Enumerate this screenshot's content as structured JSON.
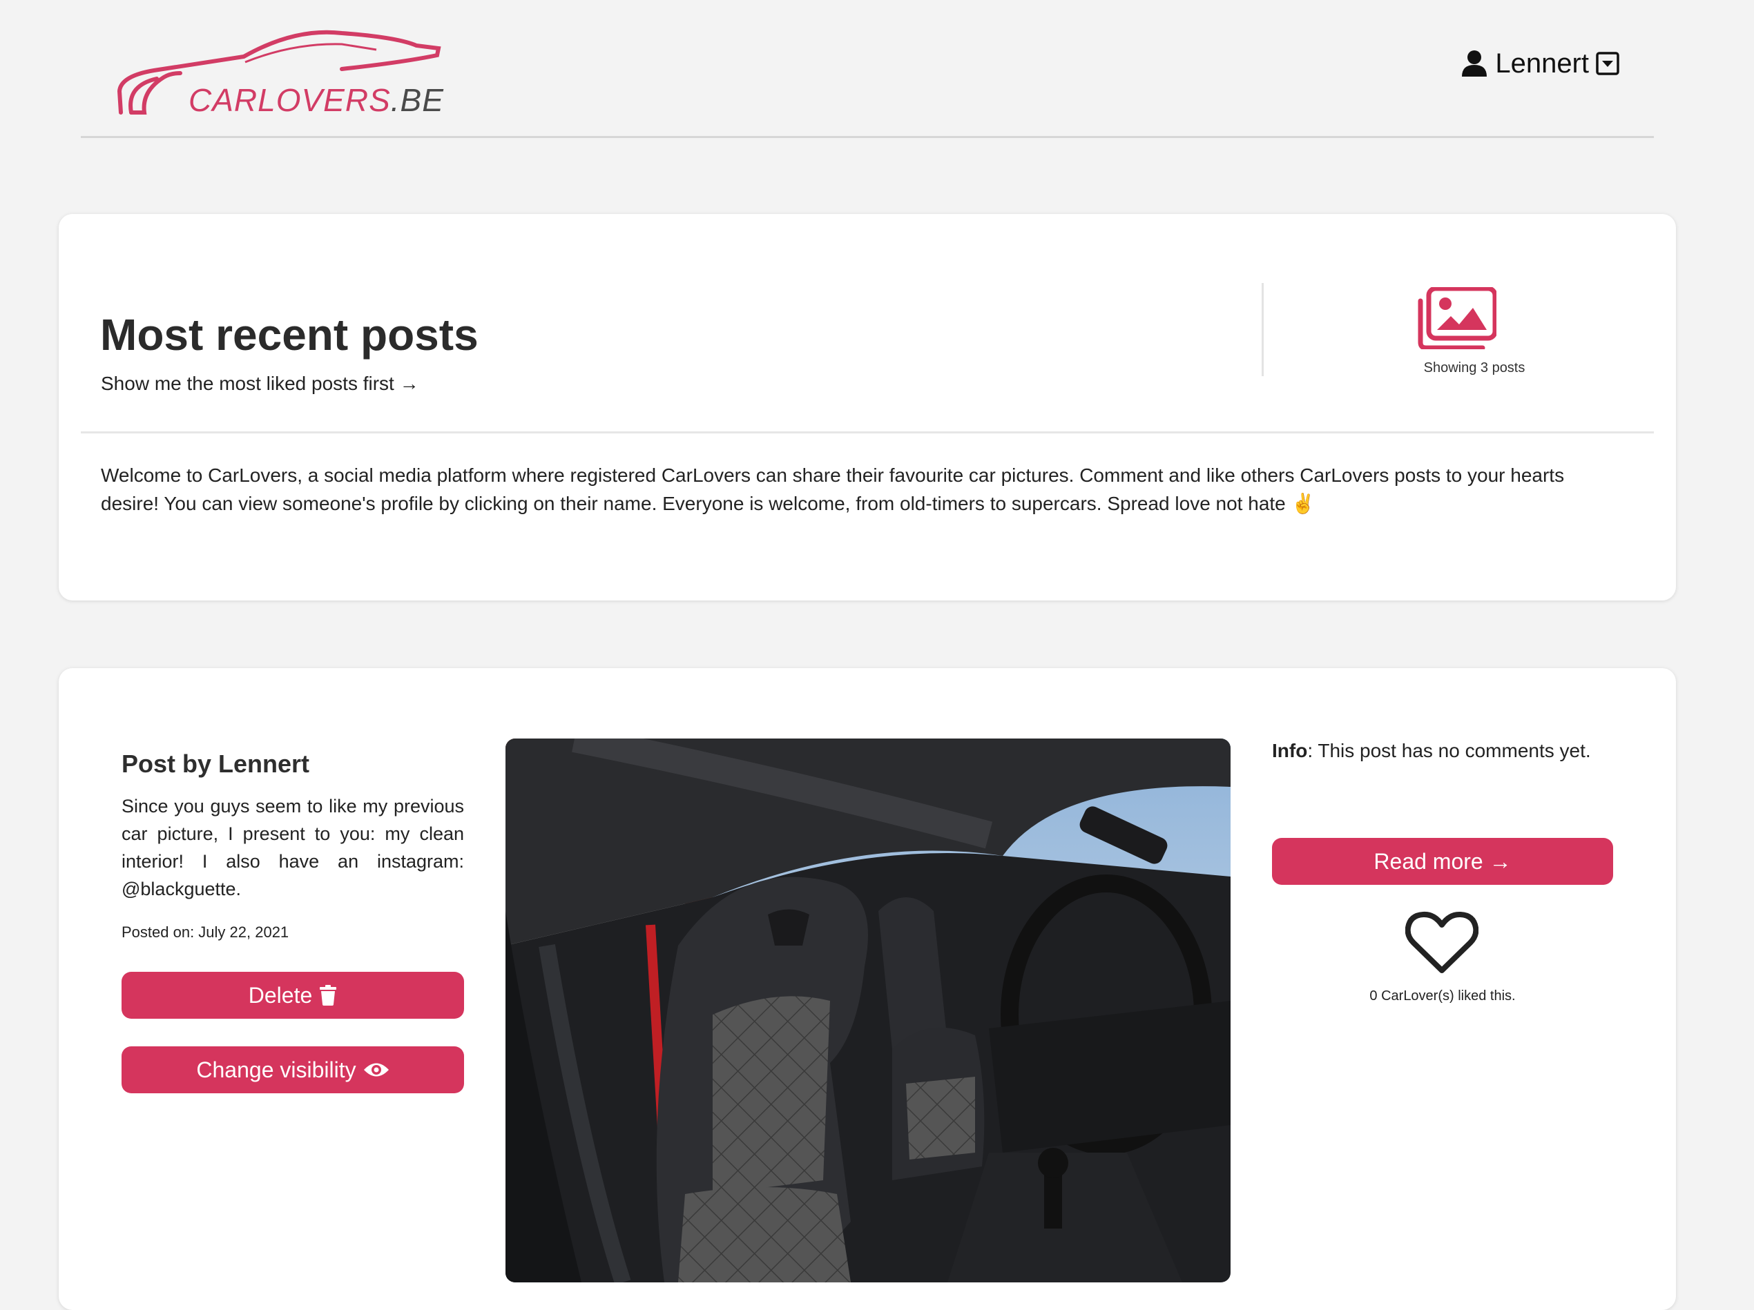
{
  "brand": {
    "logo_name": "CARLOVERS",
    "logo_suffix": ".BE",
    "accent_color": "#d5355d"
  },
  "user_menu": {
    "username": "Lennert",
    "icons": [
      "user-icon",
      "caret-square-down-icon"
    ]
  },
  "intro": {
    "title": "Most recent posts",
    "sort_link": "Show me the most liked posts first →",
    "showing": "Showing 3 posts",
    "icon": "images-icon",
    "welcome": "Welcome to CarLovers, a social media platform where registered CarLovers can share their favourite car pictures. Comment and like others CarLovers posts to your hearts desire! You can view someone's profile by clicking on their name. Everyone is welcome, from old-timers to supercars. Spread love not hate ✌️"
  },
  "post": {
    "title": "Post by Lennert",
    "body": "Since you guys seem to like my previous car picture, I present to you: my clean interior! I also have an instagram: @blackguette.",
    "posted_on": "Posted on: July 22, 2021",
    "delete_label": "Delete",
    "visibility_label": "Change visibility",
    "info_label": "Info",
    "info_text": ": This post has no comments yet.",
    "read_more_label": "Read more →",
    "likes_text": "0 CarLover(s) liked this.",
    "image_icon": "car-interior-photo"
  }
}
